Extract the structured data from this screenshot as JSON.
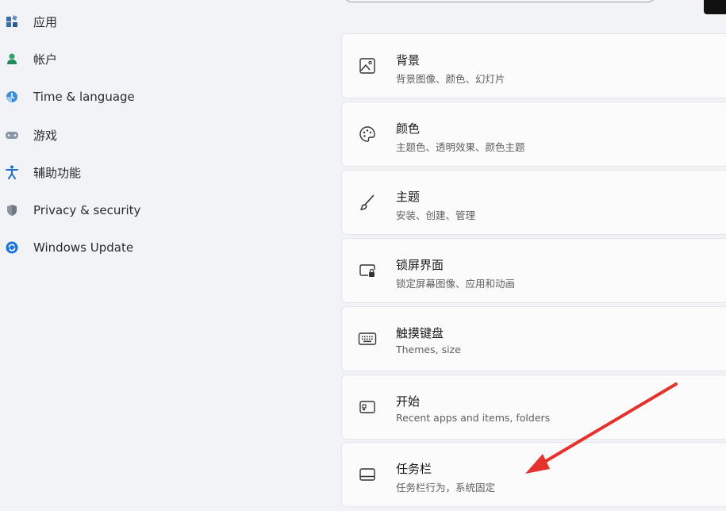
{
  "nav": {
    "items": [
      {
        "label": "应用",
        "icon": "apps-icon"
      },
      {
        "label": "帐户",
        "icon": "account-icon"
      },
      {
        "label": "Time & language",
        "icon": "time-language-icon"
      },
      {
        "label": "游戏",
        "icon": "gaming-icon"
      },
      {
        "label": "辅助功能",
        "icon": "accessibility-icon"
      },
      {
        "label": "Privacy & security",
        "icon": "shield-icon"
      },
      {
        "label": "Windows Update",
        "icon": "windows-update-icon"
      }
    ]
  },
  "cards": [
    {
      "title": "背景",
      "subtitle": "背景图像、颜色、幻灯片",
      "icon": "image-icon"
    },
    {
      "title": "颜色",
      "subtitle": "主题色、透明效果、颜色主题",
      "icon": "palette-icon"
    },
    {
      "title": "主题",
      "subtitle": "安装、创建、管理",
      "icon": "brush-icon"
    },
    {
      "title": "锁屏界面",
      "subtitle": "锁定屏幕图像、应用和动画",
      "icon": "lock-screen-icon"
    },
    {
      "title": "触摸键盘",
      "subtitle": "Themes, size",
      "icon": "keyboard-icon"
    },
    {
      "title": "开始",
      "subtitle": "Recent apps and items, folders",
      "icon": "start-icon"
    },
    {
      "title": "任务栏",
      "subtitle": "任务栏行为，系统固定",
      "icon": "taskbar-icon"
    }
  ],
  "colors": {
    "accent_blue": "#0067c0",
    "annotation_arrow": "#e5322d",
    "card_bg": "#fbfbfb",
    "page_bg": "#f1f3f6"
  }
}
